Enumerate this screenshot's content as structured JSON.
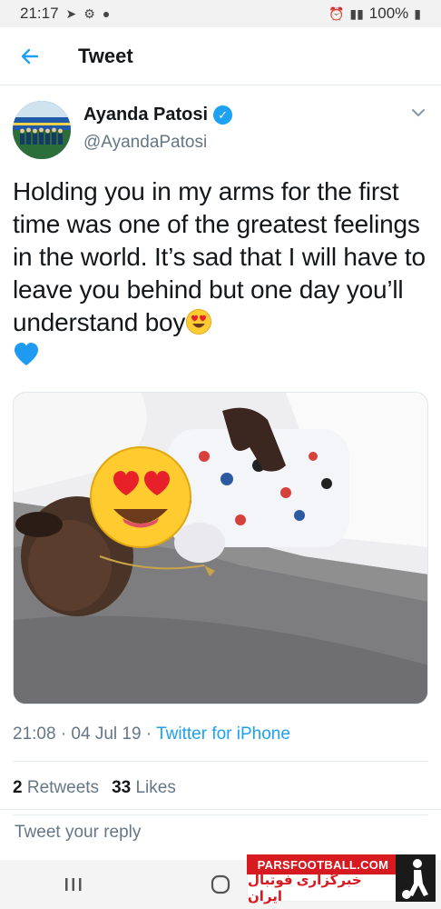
{
  "status_bar": {
    "time": "21:17",
    "battery": "100%"
  },
  "header": {
    "title": "Tweet"
  },
  "tweet": {
    "author_name": "Ayanda Patosi",
    "author_handle": "@AyandaPatosi",
    "text_main": "Holding you in my arms for the first time was one of the greatest feelings in the world. It’s sad that I will have to leave you behind but one day you’ll understand boy",
    "timestamp": "21:08 · 04 Jul 19 · ",
    "source": "Twitter for iPhone",
    "retweets_count": "2",
    "retweets_label": "Retweets",
    "likes_count": "33",
    "likes_label": "Likes"
  },
  "reply": {
    "placeholder": "Tweet your reply"
  },
  "watermark": {
    "site": "PARSFOOTBALL.COM",
    "tagline": "خبرگزاری فوتبال ایران"
  },
  "icons": {
    "back": "back-arrow-icon",
    "verified": "verified-badge-icon",
    "caret": "chevron-down-icon",
    "emoji_heart_eyes": "heart-eyes-emoji-icon",
    "emoji_blue_heart": "blue-heart-emoji-icon",
    "nav_recents": "recents-icon",
    "nav_home": "home-icon"
  },
  "colors": {
    "accent": "#1da1f2",
    "text": "#14171a",
    "secondary": "#657786",
    "watermark_red": "#d71920"
  }
}
